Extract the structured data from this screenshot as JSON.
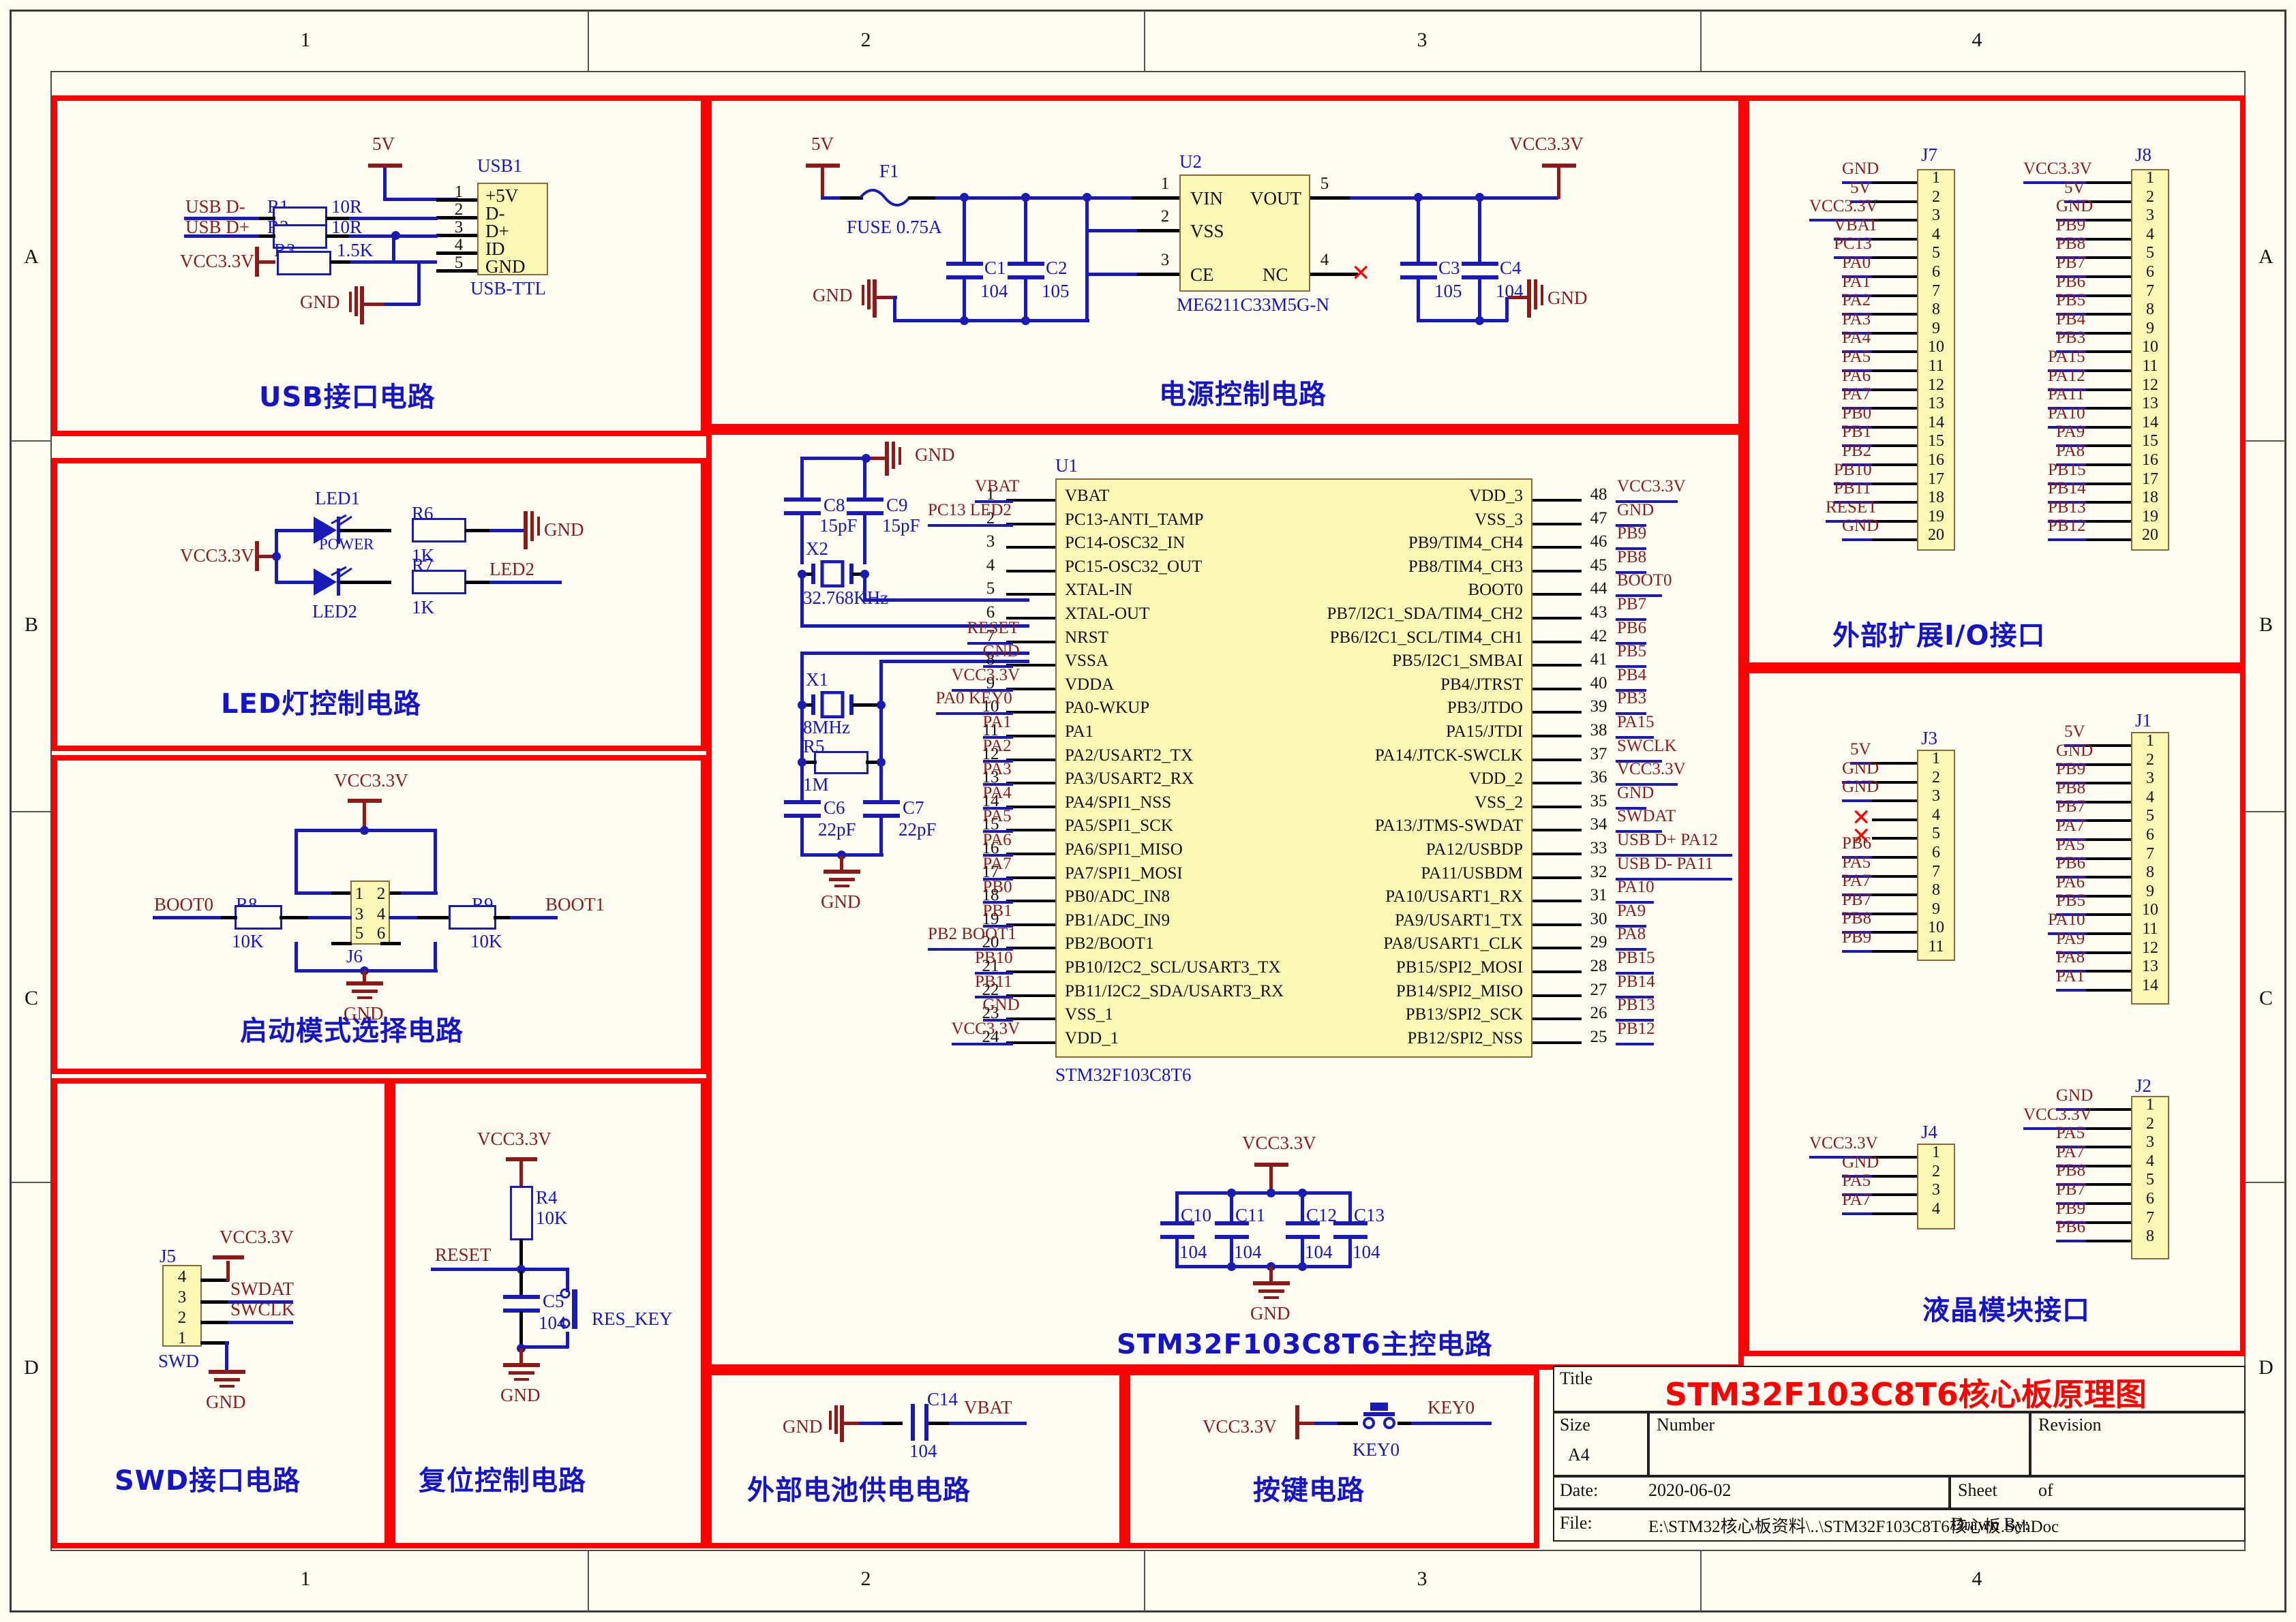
{
  "sheet": {
    "zones_top": [
      "1",
      "2",
      "3",
      "4"
    ],
    "zones_bottom": [
      "1",
      "2",
      "3",
      "4"
    ],
    "zones_left": [
      "A",
      "B",
      "C",
      "D"
    ],
    "zones_right": [
      "A",
      "B",
      "C",
      "D"
    ]
  },
  "title_block": {
    "title_label": "Title",
    "title_value": "STM32F103C8T6核心板原理图",
    "size_label": "Size",
    "size_value": "A4",
    "number_label": "Number",
    "number_value": "",
    "revision_label": "Revision",
    "revision_value": "",
    "date_label": "Date:",
    "date_value": "2020-06-02",
    "sheet_label": "Sheet",
    "sheet_of": "of",
    "file_label": "File:",
    "file_value": "E:\\STM32核心板资料\\..\\STM32F103C8T6核心板.SchDoc",
    "drawn_by_label": "Drawn By:"
  },
  "blocks": {
    "usb": {
      "title": "USB接口电路"
    },
    "led": {
      "title": "LED灯控制电路"
    },
    "boot": {
      "title": "启动模式选择电路"
    },
    "swd": {
      "title": "SWD接口电路"
    },
    "reset": {
      "title": "复位控制电路"
    },
    "power": {
      "title": "电源控制电路"
    },
    "mcu": {
      "title": "STM32F103C8T6主控电路"
    },
    "battery": {
      "title": "外部电池供电电路"
    },
    "key": {
      "title": "按键电路"
    },
    "expansion": {
      "title": "外部扩展I/O接口"
    },
    "lcd": {
      "title": "液晶模块接口"
    }
  },
  "usb_circuit": {
    "power_net": "5V",
    "gnd_net": "GND",
    "vcc_net": "VCC3.3V",
    "nets": [
      "USB_D-",
      "USB_D+"
    ],
    "net_dminus": "USB  D-",
    "net_dplus": "USB  D+",
    "resistors": [
      {
        "ref": "R1",
        "value": "10R"
      },
      {
        "ref": "R2",
        "value": "10R"
      },
      {
        "ref": "R3",
        "value": "1.5K"
      }
    ],
    "connector": {
      "ref": "USB1",
      "footprint": "USB-TTL",
      "pins": [
        {
          "num": "1",
          "name": "+5V"
        },
        {
          "num": "2",
          "name": "D-"
        },
        {
          "num": "3",
          "name": "D+"
        },
        {
          "num": "4",
          "name": "ID"
        },
        {
          "num": "5",
          "name": "GND"
        }
      ]
    }
  },
  "led_circuit": {
    "vcc_net": "VCC3.3V",
    "gnd_net": "GND",
    "leds": [
      {
        "ref": "LED1",
        "label": "POWER"
      },
      {
        "ref": "LED2",
        "label": "LED2"
      }
    ],
    "resistors": [
      {
        "ref": "R6",
        "value": "1K"
      },
      {
        "ref": "R7",
        "value": "1K"
      }
    ],
    "out_net": "LED2"
  },
  "boot_circuit": {
    "vcc_net": "VCC3.3V",
    "gnd_net": "GND",
    "net_left": "BOOT0",
    "net_right": "BOOT1",
    "resistors": [
      {
        "ref": "R8",
        "value": "10K"
      },
      {
        "ref": "R9",
        "value": "10K"
      }
    ],
    "header": {
      "ref": "J6",
      "pins": [
        "1",
        "2",
        "3",
        "4",
        "5",
        "6"
      ]
    }
  },
  "swd_circuit": {
    "vcc_net": "VCC3.3V",
    "gnd_net": "GND",
    "connector": {
      "ref": "J5",
      "footprint": "SWD",
      "pins": [
        "4",
        "3",
        "2",
        "1"
      ]
    },
    "nets": [
      "SWDAT",
      "SWCLK"
    ]
  },
  "reset_circuit": {
    "vcc_net": "VCC3.3V",
    "gnd_net": "GND",
    "resistor": {
      "ref": "R4",
      "value": "10K"
    },
    "capacitor": {
      "ref": "C5",
      "value": "104"
    },
    "net": "RESET",
    "button": "RES_KEY"
  },
  "power_circuit": {
    "in_net": "5V",
    "gnd_net": "GND",
    "out_net": "VCC3.3V",
    "fuse": {
      "ref": "F1",
      "value": "FUSE 0.75A"
    },
    "regulator": {
      "ref": "U2",
      "part": "ME6211C33M5G-N",
      "pins_left": [
        {
          "num": "1",
          "name": "VIN"
        },
        {
          "num": "2",
          "name": "VSS"
        },
        {
          "num": "3",
          "name": "CE"
        }
      ],
      "pins_right": [
        {
          "num": "5",
          "name": "VOUT"
        },
        {
          "num": "4",
          "name": "NC"
        }
      ]
    },
    "capacitors": [
      {
        "ref": "C1",
        "value": "104"
      },
      {
        "ref": "C2",
        "value": "105"
      },
      {
        "ref": "C3",
        "value": "105"
      },
      {
        "ref": "C4",
        "value": "104"
      }
    ]
  },
  "mcu_circuit": {
    "ref": "U1",
    "part": "STM32F103C8T6",
    "crystals": [
      {
        "ref": "X2",
        "value": "32.768KHz"
      },
      {
        "ref": "X1",
        "value": "8MHz"
      }
    ],
    "crystal_caps": [
      {
        "ref": "C8",
        "value": "15pF"
      },
      {
        "ref": "C9",
        "value": "15pF"
      },
      {
        "ref": "C6",
        "value": "22pF"
      },
      {
        "ref": "C7",
        "value": "22pF"
      }
    ],
    "feedback_resistor": {
      "ref": "R5",
      "value": "1M"
    },
    "gnd_net": "GND",
    "decoupling": {
      "vcc_net": "VCC3.3V",
      "gnd_net": "GND",
      "capacitors": [
        {
          "ref": "C10",
          "value": "104"
        },
        {
          "ref": "C11",
          "value": "104"
        },
        {
          "ref": "C12",
          "value": "104"
        },
        {
          "ref": "C13",
          "value": "104"
        }
      ]
    },
    "pins_left": [
      {
        "num": "1",
        "net": "VBAT",
        "name": "VBAT"
      },
      {
        "num": "2",
        "net": "PC13  LED2",
        "name": "PC13-ANTI_TAMP",
        "net2": "PC13"
      },
      {
        "num": "3",
        "net": "",
        "name": "PC14-OSC32_IN"
      },
      {
        "num": "4",
        "net": "",
        "name": "PC15-OSC32_OUT"
      },
      {
        "num": "5",
        "net": "",
        "name": "XTAL-IN"
      },
      {
        "num": "6",
        "net": "",
        "name": "XTAL-OUT"
      },
      {
        "num": "7",
        "net": "RESET",
        "name": "NRST"
      },
      {
        "num": "8",
        "net": "GND",
        "name": "VSSA"
      },
      {
        "num": "9",
        "net": "VCC3.3V",
        "name": "VDDA"
      },
      {
        "num": "10",
        "net": "PA0  KEY0",
        "name": "PA0-WKUP"
      },
      {
        "num": "11",
        "net": "PA1",
        "name": "PA1"
      },
      {
        "num": "12",
        "net": "PA2",
        "name": "PA2/USART2_TX"
      },
      {
        "num": "13",
        "net": "PA3",
        "name": "PA3/USART2_RX"
      },
      {
        "num": "14",
        "net": "PA4",
        "name": "PA4/SPI1_NSS"
      },
      {
        "num": "15",
        "net": "PA5",
        "name": "PA5/SPI1_SCK"
      },
      {
        "num": "16",
        "net": "PA6",
        "name": "PA6/SPI1_MISO"
      },
      {
        "num": "17",
        "net": "PA7",
        "name": "PA7/SPI1_MOSI"
      },
      {
        "num": "18",
        "net": "PB0",
        "name": "PB0/ADC_IN8"
      },
      {
        "num": "19",
        "net": "PB1",
        "name": "PB1/ADC_IN9"
      },
      {
        "num": "20",
        "net": "PB2  BOOT1",
        "name": "PB2/BOOT1"
      },
      {
        "num": "21",
        "net": "PB10",
        "name": "PB10/I2C2_SCL/USART3_TX"
      },
      {
        "num": "22",
        "net": "PB11",
        "name": "PB11/I2C2_SDA/USART3_RX"
      },
      {
        "num": "23",
        "net": "GND",
        "name": "VSS_1"
      },
      {
        "num": "24",
        "net": "VCC3.3V",
        "name": "VDD_1"
      }
    ],
    "pins_right": [
      {
        "num": "48",
        "net": "VCC3.3V",
        "name": "VDD_3"
      },
      {
        "num": "47",
        "net": "GND",
        "name": "VSS_3"
      },
      {
        "num": "46",
        "net": "PB9",
        "name": "PB9/TIM4_CH4"
      },
      {
        "num": "45",
        "net": "PB8",
        "name": "PB8/TIM4_CH3"
      },
      {
        "num": "44",
        "net": "BOOT0",
        "name": "BOOT0"
      },
      {
        "num": "43",
        "net": "PB7",
        "name": "PB7/I2C1_SDA/TIM4_CH2"
      },
      {
        "num": "42",
        "net": "PB6",
        "name": "PB6/I2C1_SCL/TIM4_CH1"
      },
      {
        "num": "41",
        "net": "PB5",
        "name": "PB5/I2C1_SMBAI"
      },
      {
        "num": "40",
        "net": "PB4",
        "name": "PB4/JTRST"
      },
      {
        "num": "39",
        "net": "PB3",
        "name": "PB3/JTDO"
      },
      {
        "num": "38",
        "net": "PA15",
        "name": "PA15/JTDI"
      },
      {
        "num": "37",
        "net": "SWCLK",
        "name": "PA14/JTCK-SWCLK"
      },
      {
        "num": "36",
        "net": "VCC3.3V",
        "name": "VDD_2"
      },
      {
        "num": "35",
        "net": "GND",
        "name": "VSS_2"
      },
      {
        "num": "34",
        "net": "SWDAT",
        "name": "PA13/JTMS-SWDAT"
      },
      {
        "num": "33",
        "net": "USB  D+   PA12",
        "name": "PA12/USBDP"
      },
      {
        "num": "32",
        "net": "USB  D-   PA11",
        "name": "PA11/USBDM"
      },
      {
        "num": "31",
        "net": "PA10",
        "name": "PA10/USART1_RX"
      },
      {
        "num": "30",
        "net": "PA9",
        "name": "PA9/USART1_TX"
      },
      {
        "num": "29",
        "net": "PA8",
        "name": "PA8/USART1_CLK"
      },
      {
        "num": "28",
        "net": "PB15",
        "name": "PB15/SPI2_MOSI"
      },
      {
        "num": "27",
        "net": "PB14",
        "name": "PB14/SPI2_MISO"
      },
      {
        "num": "26",
        "net": "PB13",
        "name": "PB13/SPI2_SCK"
      },
      {
        "num": "25",
        "net": "PB12",
        "name": "PB12/SPI2_NSS"
      }
    ]
  },
  "battery_circuit": {
    "gnd_net": "GND",
    "out_net": "VBAT",
    "capacitor": {
      "ref": "C14",
      "value": "104"
    }
  },
  "key_circuit": {
    "vcc_net": "VCC3.3V",
    "out_net": "KEY0",
    "button": "KEY0"
  },
  "connectors": {
    "J7": {
      "ref": "J7",
      "nets": [
        "GND",
        "5V",
        "VCC3.3V",
        "VBAT",
        "PC13",
        "PA0",
        "PA1",
        "PA2",
        "PA3",
        "PA4",
        "PA5",
        "PA6",
        "PA7",
        "PB0",
        "PB1",
        "PB2",
        "PB10",
        "PB11",
        "RESET",
        "GND"
      ],
      "pins": [
        "1",
        "2",
        "3",
        "4",
        "5",
        "6",
        "7",
        "8",
        "9",
        "10",
        "11",
        "12",
        "13",
        "14",
        "15",
        "16",
        "17",
        "18",
        "19",
        "20"
      ]
    },
    "J8": {
      "ref": "J8",
      "nets": [
        "VCC3.3V",
        "5V",
        "GND",
        "PB9",
        "PB8",
        "PB7",
        "PB6",
        "PB5",
        "PB4",
        "PB3",
        "PA15",
        "PA12",
        "PA11",
        "PA10",
        "PA9",
        "PA8",
        "PB15",
        "PB14",
        "PB13",
        "PB12"
      ],
      "pins": [
        "1",
        "2",
        "3",
        "4",
        "5",
        "6",
        "7",
        "8",
        "9",
        "10",
        "11",
        "12",
        "13",
        "14",
        "15",
        "16",
        "17",
        "18",
        "19",
        "20"
      ]
    },
    "J3": {
      "ref": "J3",
      "nets": [
        "5V",
        "GND",
        "GND",
        "",
        "",
        "PB6",
        "PA5",
        "PA7",
        "PB7",
        "PB8",
        "PB9"
      ],
      "pins": [
        "1",
        "2",
        "3",
        "4",
        "5",
        "6",
        "7",
        "8",
        "9",
        "10",
        "11"
      ],
      "nc_pins": [
        "4",
        "5"
      ]
    },
    "J1": {
      "ref": "J1",
      "nets": [
        "5V",
        "GND",
        "PB9",
        "PB8",
        "PB7",
        "PA7",
        "PA5",
        "PB6",
        "PA6",
        "PB5",
        "PA10",
        "PA9",
        "PA8",
        "PA1"
      ],
      "pins": [
        "1",
        "2",
        "3",
        "4",
        "5",
        "6",
        "7",
        "8",
        "9",
        "10",
        "11",
        "12",
        "13",
        "14"
      ]
    },
    "J4": {
      "ref": "J4",
      "nets": [
        "VCC3.3V",
        "GND",
        "PA5",
        "PA7"
      ],
      "pins": [
        "1",
        "2",
        "3",
        "4"
      ]
    },
    "J2": {
      "ref": "J2",
      "nets": [
        "GND",
        "VCC3.3V",
        "PA5",
        "PA7",
        "PB8",
        "PB7",
        "PB9",
        "PB6"
      ],
      "pins": [
        "1",
        "2",
        "3",
        "4",
        "5",
        "6",
        "7",
        "8"
      ]
    }
  },
  "colors": {
    "wire_blue": "#1a1ab4",
    "net_red": "#8b1a1a",
    "box_red": "#ff0000",
    "part_fill": "#fbf7b5",
    "cn_blue": "#1414c8",
    "paper": "#fffdf2"
  }
}
